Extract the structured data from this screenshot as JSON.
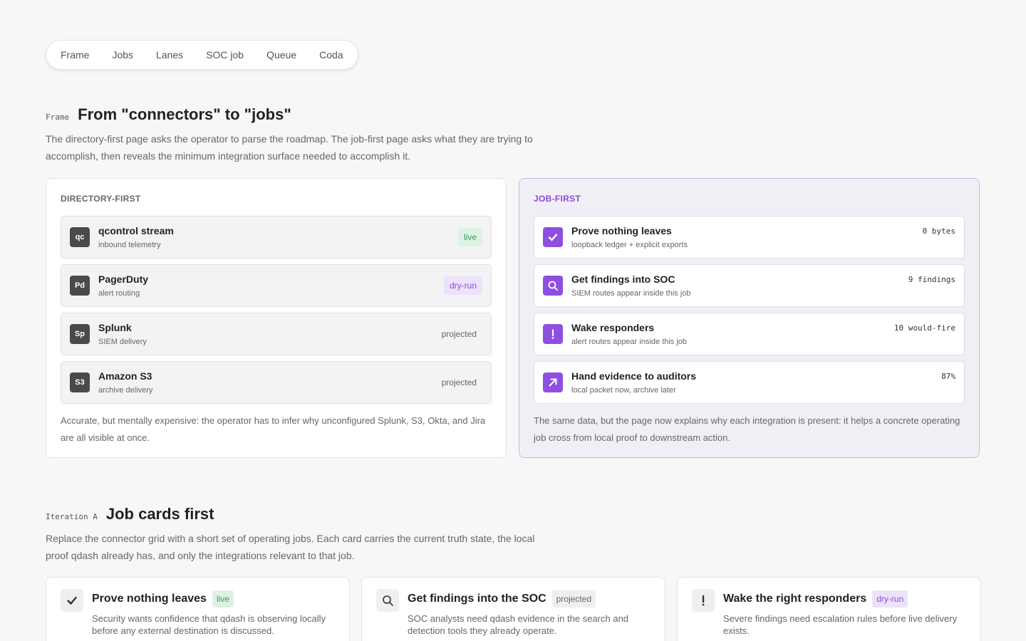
{
  "nav": [
    "Frame",
    "Jobs",
    "Lanes",
    "SOC job",
    "Queue",
    "Coda"
  ],
  "frame": {
    "kicker": "Frame",
    "title": "From \"connectors\" to \"jobs\"",
    "desc": "The directory-first page asks the operator to parse the roadmap. The job-first page asks what they are trying to accomplish, then reveals the minimum integration surface needed to accomplish it."
  },
  "directory": {
    "label": "DIRECTORY-FIRST",
    "rows": [
      {
        "abbr": "qc",
        "title": "qcontrol stream",
        "sub": "inbound telemetry",
        "status": "live"
      },
      {
        "abbr": "Pd",
        "title": "PagerDuty",
        "sub": "alert routing",
        "status": "dry-run"
      },
      {
        "abbr": "Sp",
        "title": "Splunk",
        "sub": "SIEM delivery",
        "status": "projected"
      },
      {
        "abbr": "S3",
        "title": "Amazon S3",
        "sub": "archive delivery",
        "status": "projected"
      }
    ],
    "note": "Accurate, but mentally expensive: the operator has to infer why unconfigured Splunk, S3, Okta, and Jira are all visible at once."
  },
  "jobfirst": {
    "label": "JOB-FIRST",
    "rows": [
      {
        "icon": "check-icon",
        "title": "Prove nothing leaves",
        "sub": "loopback ledger + explicit exports",
        "metric": "0 bytes"
      },
      {
        "icon": "search-icon",
        "title": "Get findings into SOC",
        "sub": "SIEM routes appear inside this job",
        "metric": "9 findings"
      },
      {
        "icon": "exclamation-icon",
        "title": "Wake responders",
        "sub": "alert routes appear inside this job",
        "metric": "10 would-fire"
      },
      {
        "icon": "arrow-up-right-icon",
        "title": "Hand evidence to auditors",
        "sub": "local packet now, archive later",
        "metric": "87%"
      }
    ],
    "note": "The same data, but the page now explains why each integration is present: it helps a concrete operating job cross from local proof to downstream action."
  },
  "iteration": {
    "kicker": "Iteration A",
    "title": "Job cards first",
    "desc": "Replace the connector grid with a short set of operating jobs. Each card carries the current truth state, the local proof qdash already has, and only the integrations relevant to that job."
  },
  "cards": [
    {
      "icon": "check-icon",
      "title": "Prove nothing leaves",
      "status": "live",
      "desc": "Security wants confidence that qdash is observing locally before any external destination is discussed."
    },
    {
      "icon": "search-icon",
      "title": "Get findings into the SOC",
      "status": "projected",
      "desc": "SOC analysts need qdash evidence in the search and detection tools they already operate."
    },
    {
      "icon": "exclamation-icon",
      "title": "Wake the right responders",
      "status": "dry-run",
      "desc": "Severe findings need escalation rules before live delivery exists."
    }
  ],
  "colors": {
    "accent": "#8e4fe0",
    "live": "#2aa05a",
    "dry_run": "#8b4ad6"
  }
}
